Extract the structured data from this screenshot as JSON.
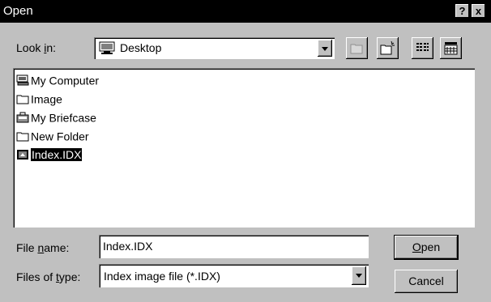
{
  "window": {
    "title": "Open",
    "help_glyph": "?",
    "close_glyph": "x"
  },
  "look_in": {
    "label_before": "Look ",
    "label_accel": "i",
    "label_after": "n:",
    "value": "Desktop"
  },
  "files": [
    {
      "name": "My Computer",
      "icon": "computer-icon"
    },
    {
      "name": "Image",
      "icon": "folder-icon"
    },
    {
      "name": "My Briefcase",
      "icon": "briefcase-icon"
    },
    {
      "name": "New Folder",
      "icon": "folder-icon"
    },
    {
      "name": "Index.IDX",
      "icon": "idx-file-icon",
      "selected": true
    }
  ],
  "file_name": {
    "label_before": "File ",
    "label_accel": "n",
    "label_after": "ame:",
    "value": "Index.IDX"
  },
  "file_type": {
    "label_before": "Files of ",
    "label_accel": "t",
    "label_after": "ype:",
    "value": "Index image file (*.IDX)"
  },
  "buttons": {
    "open_accel": "O",
    "open_rest": "pen",
    "cancel": "Cancel"
  }
}
